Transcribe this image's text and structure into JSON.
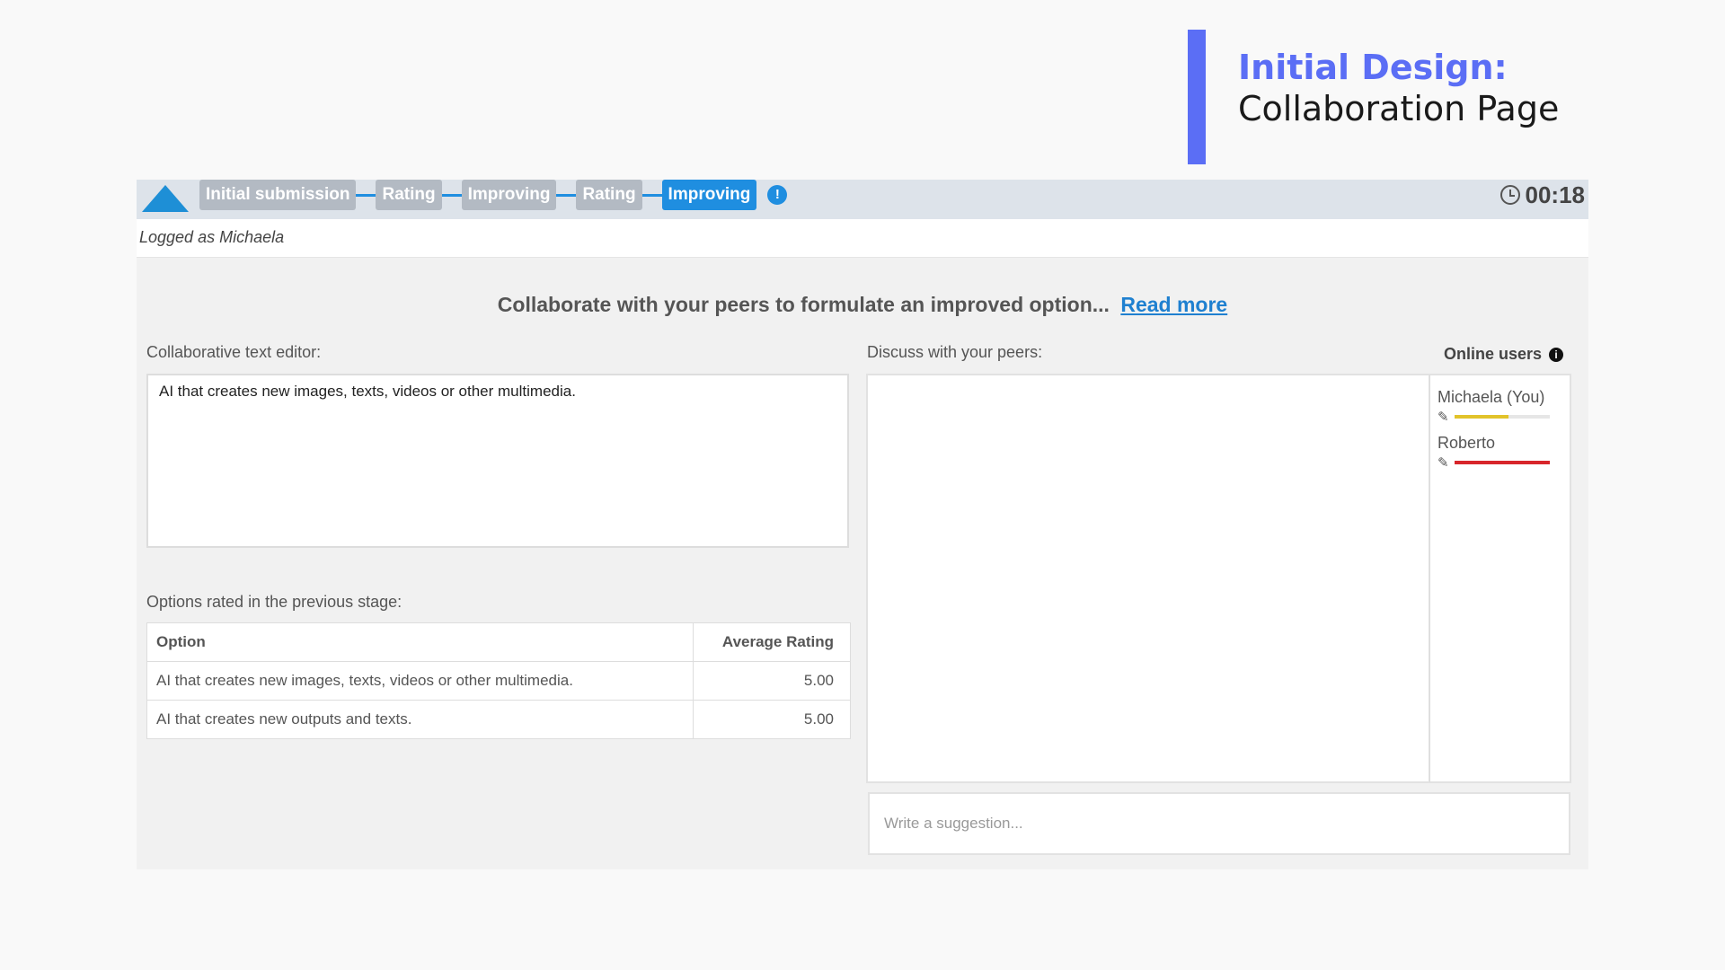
{
  "slide": {
    "title_line1": "Initial Design:",
    "title_line2": "Collaboration Page",
    "accent_color": "#5b6ef5"
  },
  "app": {
    "logo_icon": "triangle-logo-icon",
    "steps": [
      {
        "label": "Initial submission",
        "active": false
      },
      {
        "label": "Rating",
        "active": false
      },
      {
        "label": "Improving",
        "active": false
      },
      {
        "label": "Rating",
        "active": false
      },
      {
        "label": "Improving",
        "active": true
      }
    ],
    "steps_info_symbol": "!",
    "timer": "00:18",
    "logged_as": "Logged as Michaela",
    "instruction": "Collaborate with your peers to formulate an improved option...",
    "read_more": "Read more",
    "editor": {
      "label": "Collaborative text editor:",
      "text": "AI that creates new images, texts, videos or other multimedia."
    },
    "options": {
      "label": "Options rated in the previous stage:",
      "headers": [
        "Option",
        "Average Rating"
      ],
      "rows": [
        {
          "option": "AI that creates new images, texts, videos or other multimedia.",
          "rating": "5.00"
        },
        {
          "option": "AI that creates new outputs and texts.",
          "rating": "5.00"
        }
      ]
    },
    "discussion": {
      "label": "Discuss with your peers:",
      "placeholder": "Write a suggestion..."
    },
    "online": {
      "title": "Online users",
      "info_symbol": "i",
      "users": [
        {
          "name": "Michaela (You)",
          "activity_level": 0.57,
          "color": "#e2c32a"
        },
        {
          "name": "Roberto",
          "activity_level": 1.0,
          "color": "#d8262b"
        }
      ]
    },
    "colors": {
      "primary_blue": "#1f8ee0",
      "inactive_step": "#b3bac3"
    }
  }
}
